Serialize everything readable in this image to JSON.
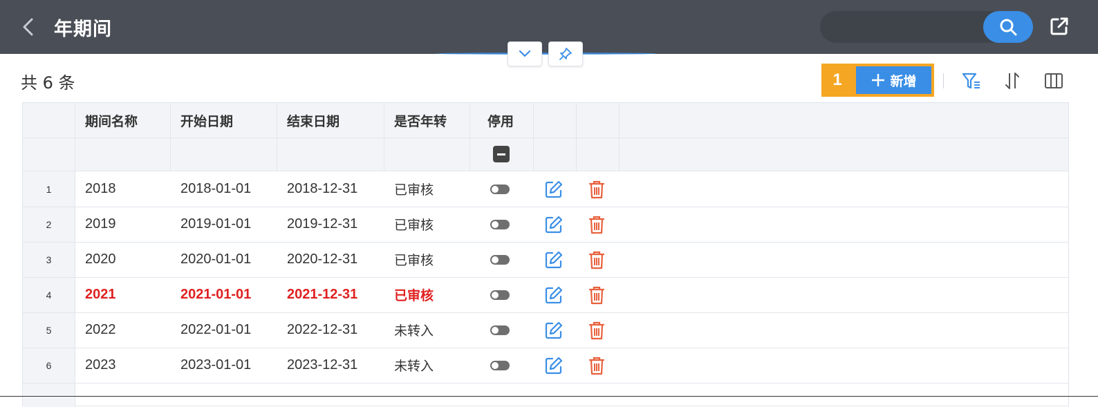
{
  "header": {
    "title": "年期间",
    "search_placeholder": "",
    "colors": {
      "bar": "#4a4f57",
      "accent": "#3a8ee6"
    },
    "icons": [
      "chevron-left-icon",
      "search-icon",
      "export-icon"
    ]
  },
  "collapse_controls": {
    "icons": [
      "chevron-down-icon",
      "pin-icon"
    ]
  },
  "toolbar": {
    "record_count": "共 6 条",
    "step_badge": "1",
    "add_label": "新增",
    "icons": [
      "filter-icon",
      "sort-icon",
      "columns-icon"
    ]
  },
  "table": {
    "columns": [
      "期间名称",
      "开始日期",
      "结束日期",
      "是否年转",
      "停用"
    ],
    "rows": [
      {
        "index": "1",
        "name": "2018",
        "start": "2018-01-01",
        "end": "2018-12-31",
        "status": "已审核",
        "disabled": false,
        "highlight": false
      },
      {
        "index": "2",
        "name": "2019",
        "start": "2019-01-01",
        "end": "2019-12-31",
        "status": "已审核",
        "disabled": false,
        "highlight": false
      },
      {
        "index": "3",
        "name": "2020",
        "start": "2020-01-01",
        "end": "2020-12-31",
        "status": "已审核",
        "disabled": false,
        "highlight": false
      },
      {
        "index": "4",
        "name": "2021",
        "start": "2021-01-01",
        "end": "2021-12-31",
        "status": "已审核",
        "disabled": false,
        "highlight": true
      },
      {
        "index": "5",
        "name": "2022",
        "start": "2022-01-01",
        "end": "2022-12-31",
        "status": "未转入",
        "disabled": false,
        "highlight": false
      },
      {
        "index": "6",
        "name": "2023",
        "start": "2023-01-01",
        "end": "2023-12-31",
        "status": "未转入",
        "disabled": false,
        "highlight": false
      }
    ],
    "colors": {
      "highlight": "#e02020",
      "edit": "#3a8ee6",
      "delete": "#e8603c"
    }
  }
}
